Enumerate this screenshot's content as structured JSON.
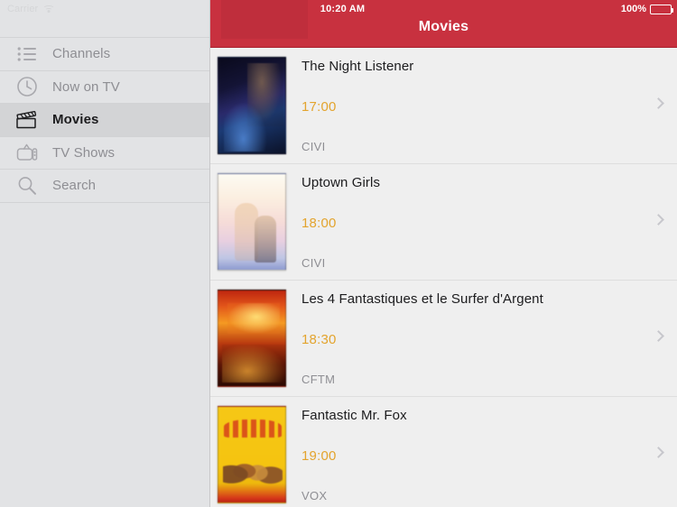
{
  "statusbar": {
    "carrier": "Carrier",
    "wifi_icon": "wifi-icon",
    "time": "10:20 AM",
    "battery_percent": "100%",
    "battery_icon": "battery-full-icon"
  },
  "navbar": {
    "title": "Movies",
    "background_color": "#c8313f"
  },
  "sidebar": {
    "background_color": "#e2e3e5",
    "items": [
      {
        "label": "Channels",
        "icon": "list-icon",
        "selected": false
      },
      {
        "label": "Now on TV",
        "icon": "clock-icon",
        "selected": false
      },
      {
        "label": "Movies",
        "icon": "clapperboard-icon",
        "selected": true
      },
      {
        "label": "TV Shows",
        "icon": "television-icon",
        "selected": false
      },
      {
        "label": "Search",
        "icon": "search-icon",
        "selected": false
      }
    ]
  },
  "list": {
    "accent_time_color": "#e3a42e",
    "channel_color": "#8e8e93",
    "disclosure_icon": "chevron-right-icon",
    "rows": [
      {
        "title": "The Night Listener",
        "time": "17:00",
        "channel": "CIVI"
      },
      {
        "title": "Uptown Girls",
        "time": "18:00",
        "channel": "CIVI"
      },
      {
        "title": "Les 4 Fantastiques et le Surfer d'Argent",
        "time": "18:30",
        "channel": "CFTM"
      },
      {
        "title": "Fantastic Mr. Fox",
        "time": "19:00",
        "channel": "VOX"
      }
    ]
  }
}
